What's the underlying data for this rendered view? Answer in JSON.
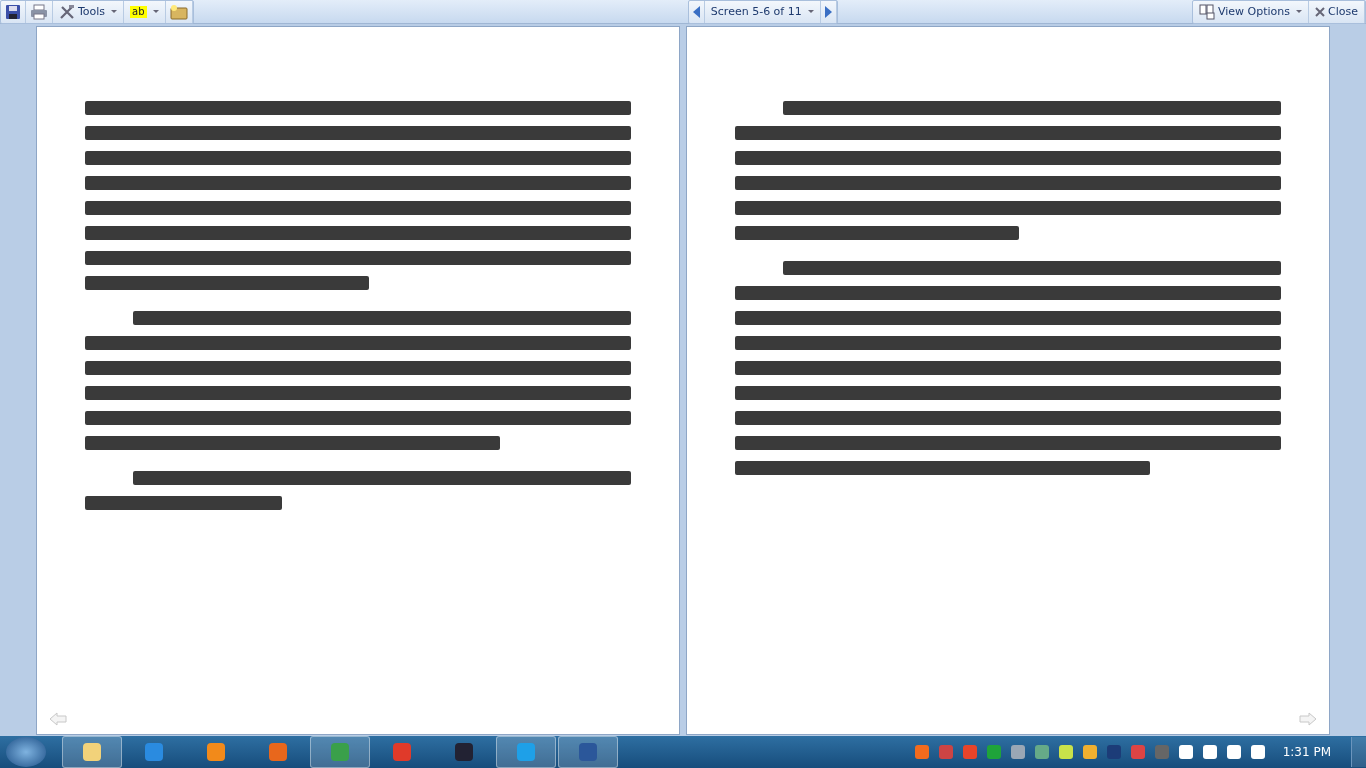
{
  "toolbar": {
    "left": [
      {
        "kind": "save"
      },
      {
        "kind": "print"
      },
      {
        "kind": "tools",
        "label": "Tools"
      },
      {
        "kind": "highlight",
        "label": "ab"
      },
      {
        "kind": "folder"
      }
    ],
    "navigator": {
      "label": "Screen 5-6 of 11"
    },
    "right": [
      {
        "kind": "view",
        "label": "View Options"
      },
      {
        "kind": "close",
        "label": "Close"
      }
    ]
  },
  "pages": [
    {
      "kind": "left",
      "paragraphs": [
        {
          "indent": false,
          "lines": [
            {
              "kind": "full"
            },
            {
              "kind": "full"
            },
            {
              "kind": "full"
            },
            {
              "kind": "full"
            },
            {
              "kind": "full"
            },
            {
              "kind": "full"
            },
            {
              "kind": "full"
            },
            {
              "kind": "half"
            }
          ]
        },
        {
          "indent": true,
          "lines": [
            {
              "kind": "full"
            },
            {
              "kind": "full"
            },
            {
              "kind": "full"
            },
            {
              "kind": "full"
            },
            {
              "kind": "full"
            },
            {
              "kind": "long"
            }
          ]
        },
        {
          "indent": true,
          "lines": [
            {
              "kind": "full"
            },
            {
              "kind": "short"
            }
          ]
        }
      ]
    },
    {
      "kind": "right",
      "paragraphs": [
        {
          "indent": true,
          "lines": [
            {
              "kind": "full"
            },
            {
              "kind": "full"
            },
            {
              "kind": "full"
            },
            {
              "kind": "full"
            },
            {
              "kind": "full"
            },
            {
              "kind": "half"
            }
          ]
        },
        {
          "indent": true,
          "lines": [
            {
              "kind": "full"
            },
            {
              "kind": "full"
            },
            {
              "kind": "full"
            },
            {
              "kind": "full"
            },
            {
              "kind": "full"
            },
            {
              "kind": "full"
            },
            {
              "kind": "full"
            },
            {
              "kind": "full"
            },
            {
              "kind": "long"
            }
          ]
        }
      ]
    }
  ],
  "taskbar": {
    "apps": [
      {
        "kind": "explorer",
        "running": true
      },
      {
        "kind": "ie",
        "running": false
      },
      {
        "kind": "media",
        "running": false
      },
      {
        "kind": "firefox",
        "running": false
      },
      {
        "kind": "chrome",
        "running": true
      },
      {
        "kind": "recorder",
        "running": false
      },
      {
        "kind": "gear",
        "running": false
      },
      {
        "kind": "skype",
        "running": true
      },
      {
        "kind": "word",
        "running": true
      }
    ],
    "tray": [
      {
        "kind": "antivirus"
      },
      {
        "kind": "network-app"
      },
      {
        "kind": "crop"
      },
      {
        "kind": "triangle"
      },
      {
        "kind": "window"
      },
      {
        "kind": "people"
      },
      {
        "kind": "lime"
      },
      {
        "kind": "bolt"
      },
      {
        "kind": "bluetooth"
      },
      {
        "kind": "speaker-warn"
      },
      {
        "kind": "monitor"
      },
      {
        "kind": "battery"
      },
      {
        "kind": "signal"
      },
      {
        "kind": "flag"
      },
      {
        "kind": "volume"
      }
    ],
    "clock": "1:31 PM"
  }
}
